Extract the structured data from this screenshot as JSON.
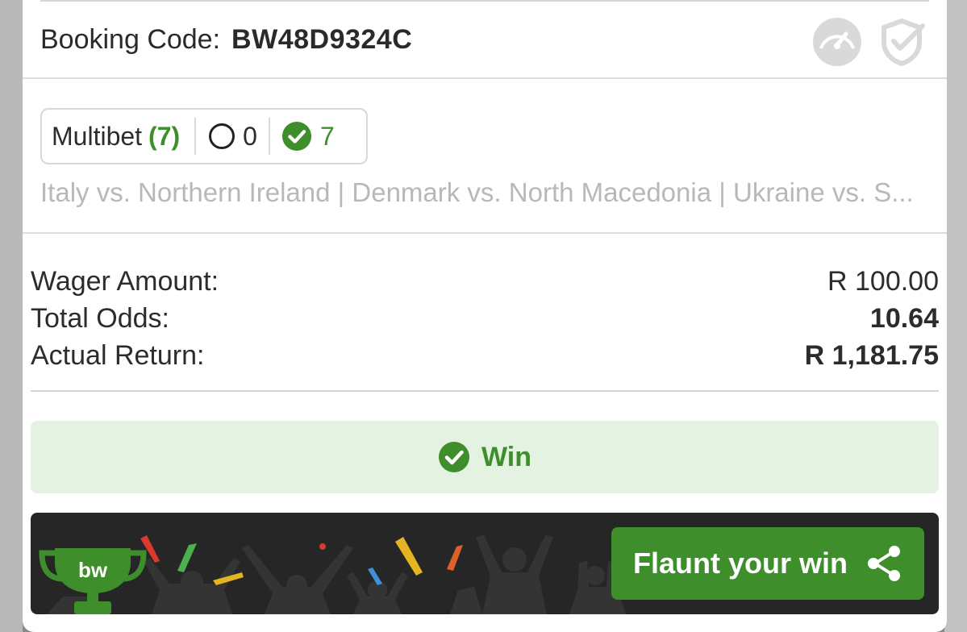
{
  "booking": {
    "label": "Booking Code:",
    "code": "BW48D9324C"
  },
  "icons": {
    "gauge": "speedometer-icon",
    "shield": "shield-check-icon"
  },
  "bet": {
    "type_label": "Multibet",
    "selection_count": "(7)",
    "open_count": "0",
    "won_count": "7",
    "matches": "Italy vs. Northern Ireland | Denmark vs. North Macedonia | Ukraine vs. S..."
  },
  "summary": {
    "wager_label": "Wager Amount:",
    "wager_value": "R 100.00",
    "odds_label": "Total Odds:",
    "odds_value": "10.64",
    "return_label": "Actual Return:",
    "return_value": "R 1,181.75"
  },
  "status": {
    "label": "Win"
  },
  "banner": {
    "logo_text": "bw",
    "button_label": "Flaunt your win"
  },
  "colors": {
    "accent_green": "#3f8e2c",
    "win_bg": "#e4f2e1",
    "banner_bg": "#262626"
  }
}
